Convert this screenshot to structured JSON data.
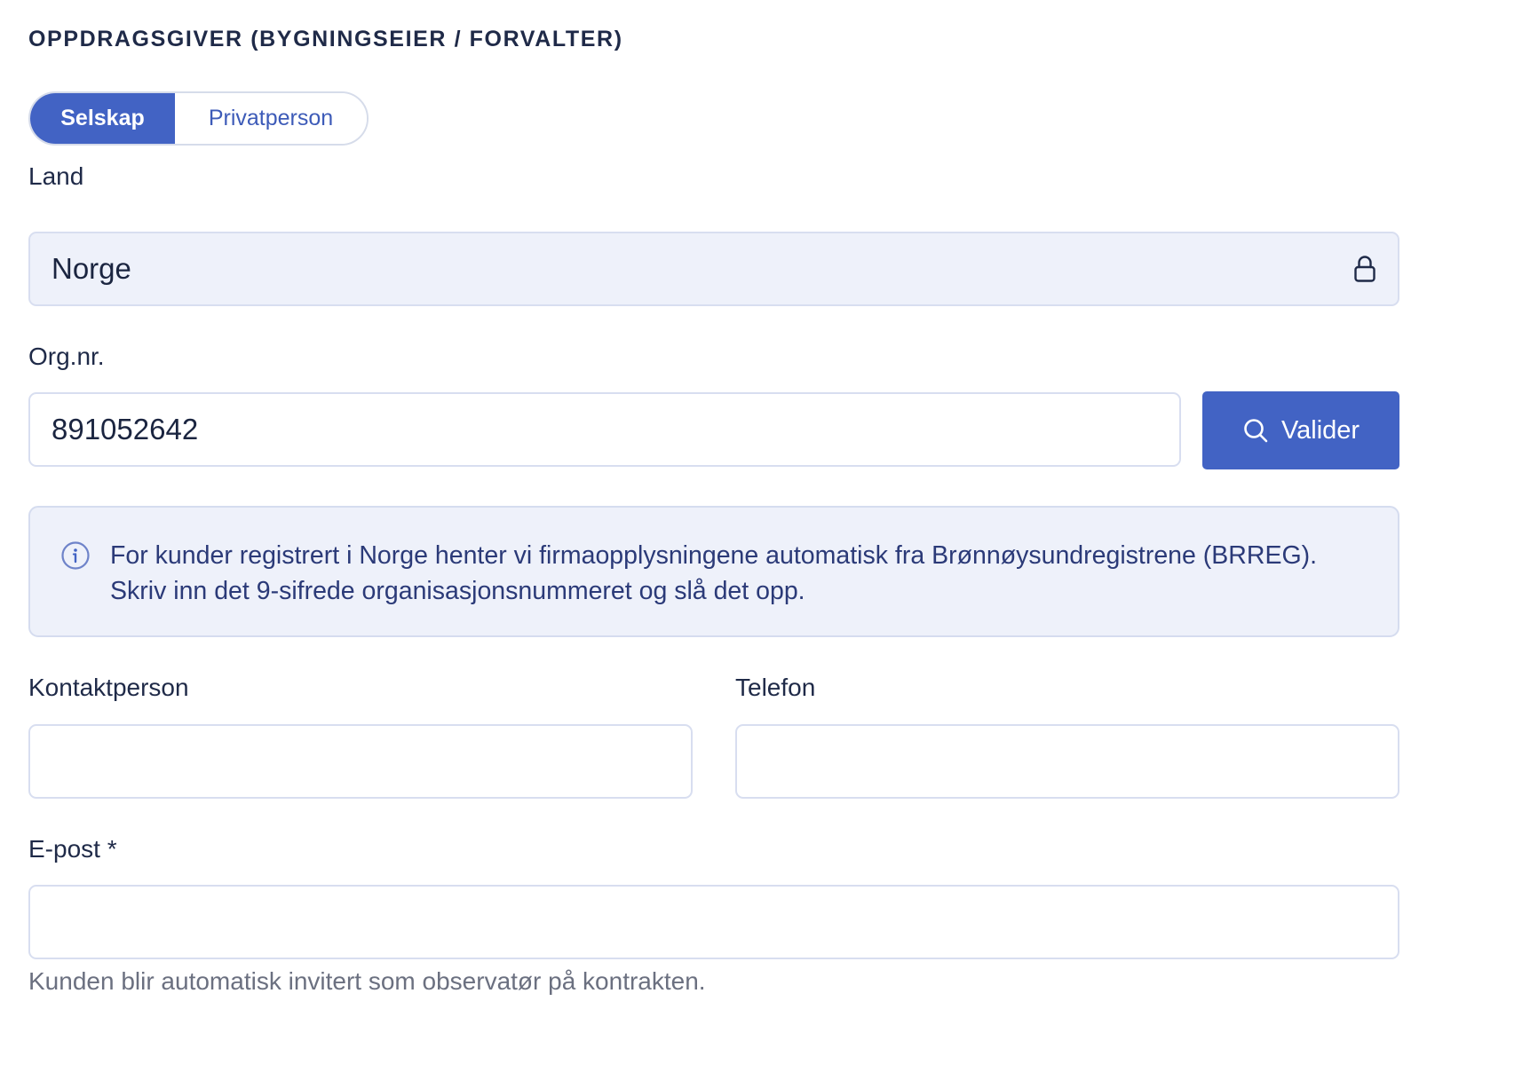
{
  "section": {
    "title": "OPPDRAGSGIVER (BYGNINGSEIER / FORVALTER)"
  },
  "customer_type": {
    "options": [
      "Selskap",
      "Privatperson"
    ],
    "selected": "Selskap"
  },
  "country": {
    "label": "Land",
    "value": "Norge",
    "icon": "lock-icon"
  },
  "org_number": {
    "label": "Org.nr.",
    "value": "891052642",
    "validate_label": "Valider",
    "validate_icon": "search-icon"
  },
  "info": {
    "icon": "info-icon",
    "text": "For kunder registrert i Norge henter vi firmaopplysningene automatisk fra Brønnøysundregistrene (BRREG). Skriv inn det 9-sifrede organisasjonsnummeret og slå det opp."
  },
  "contact_person": {
    "label": "Kontaktperson",
    "value": ""
  },
  "phone": {
    "label": "Telefon",
    "value": ""
  },
  "email": {
    "label": "E-post *",
    "value": "",
    "hint": "Kunden blir automatisk invitert som observatør på kontrakten."
  },
  "colors": {
    "accent": "#4263c4",
    "info_background": "#eef1fa",
    "text": "#1f2a48",
    "muted": "#6b7080"
  }
}
